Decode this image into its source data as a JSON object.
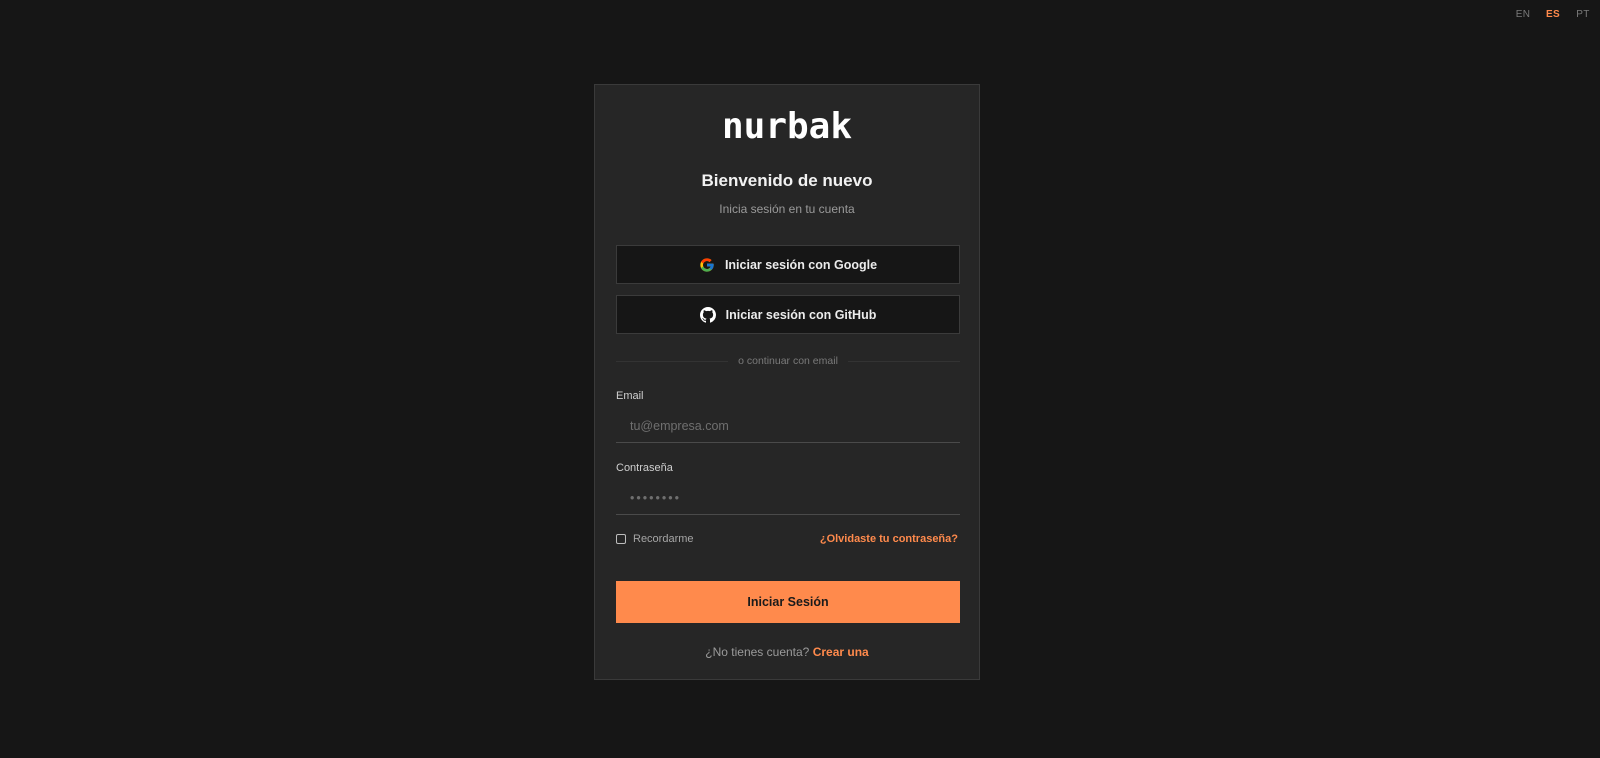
{
  "languages": {
    "en": "EN",
    "es": "ES",
    "pt": "PT",
    "active": "ES"
  },
  "brand": {
    "logo": "nurbak",
    "accent_color": "#ff8a4c"
  },
  "login": {
    "title": "Bienvenido de nuevo",
    "subtitle": "Inicia sesión en tu cuenta",
    "google_label": "Iniciar sesión con Google",
    "github_label": "Iniciar sesión con GitHub",
    "divider_text": "o continuar con email",
    "email_label": "Email",
    "email_placeholder": "tu@empresa.com",
    "password_label": "Contraseña",
    "password_placeholder": "••••••••",
    "remember_label": "Recordarme",
    "forgot_label": "¿Olvidaste tu contraseña?",
    "submit_label": "Iniciar Sesión",
    "no_account_text": "¿No tienes cuenta?",
    "create_label": "Crear una"
  },
  "icons": {
    "google": "google-icon",
    "github": "github-icon"
  }
}
